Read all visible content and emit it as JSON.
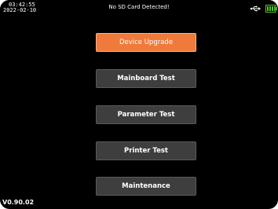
{
  "status_bar": {
    "time": "03:42:55",
    "date": "2022-02-10",
    "message": "No SD Card Detected!",
    "usb_icon": "usb-icon",
    "battery_icon": "battery-icon",
    "battery_color": "#5cbf2a"
  },
  "menu": {
    "items": [
      {
        "label": "Device Upgrade"
      },
      {
        "label": "Mainboard Test"
      },
      {
        "label": "Parameter Test"
      },
      {
        "label": "Printer Test"
      },
      {
        "label": "Maintenance"
      }
    ],
    "selected_color": "#f07a3c"
  },
  "footer": {
    "version": "V0.90.02"
  }
}
